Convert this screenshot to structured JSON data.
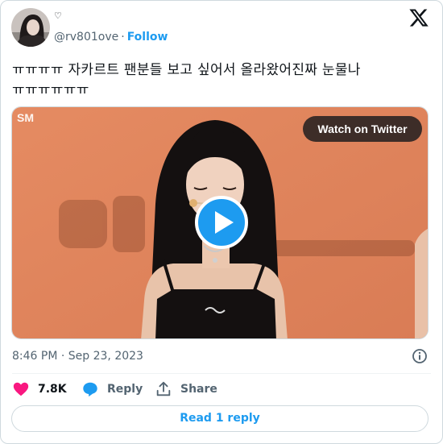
{
  "author": {
    "name_badge": "♡",
    "handle": "@rv801ove",
    "separator": "·",
    "follow_label": "Follow"
  },
  "tweet": {
    "text": "ㅠㅠㅠㅠ 자카르트 팬분들 보고 싶어서 올라왔어진짜 눈물나 ㅠㅠㅠㅠㅠㅠ",
    "timestamp": "8:46 PM · Sep 23, 2023"
  },
  "media": {
    "watch_label": "Watch on Twitter",
    "watermark": "SM"
  },
  "actions": {
    "like_count": "7.8K",
    "reply_label": "Reply",
    "share_label": "Share",
    "read_replies_label": "Read 1 reply"
  },
  "colors": {
    "accent": "#1d9bf0",
    "like": "#f91880",
    "muted": "#536471",
    "stage_background": "#e48a62"
  }
}
